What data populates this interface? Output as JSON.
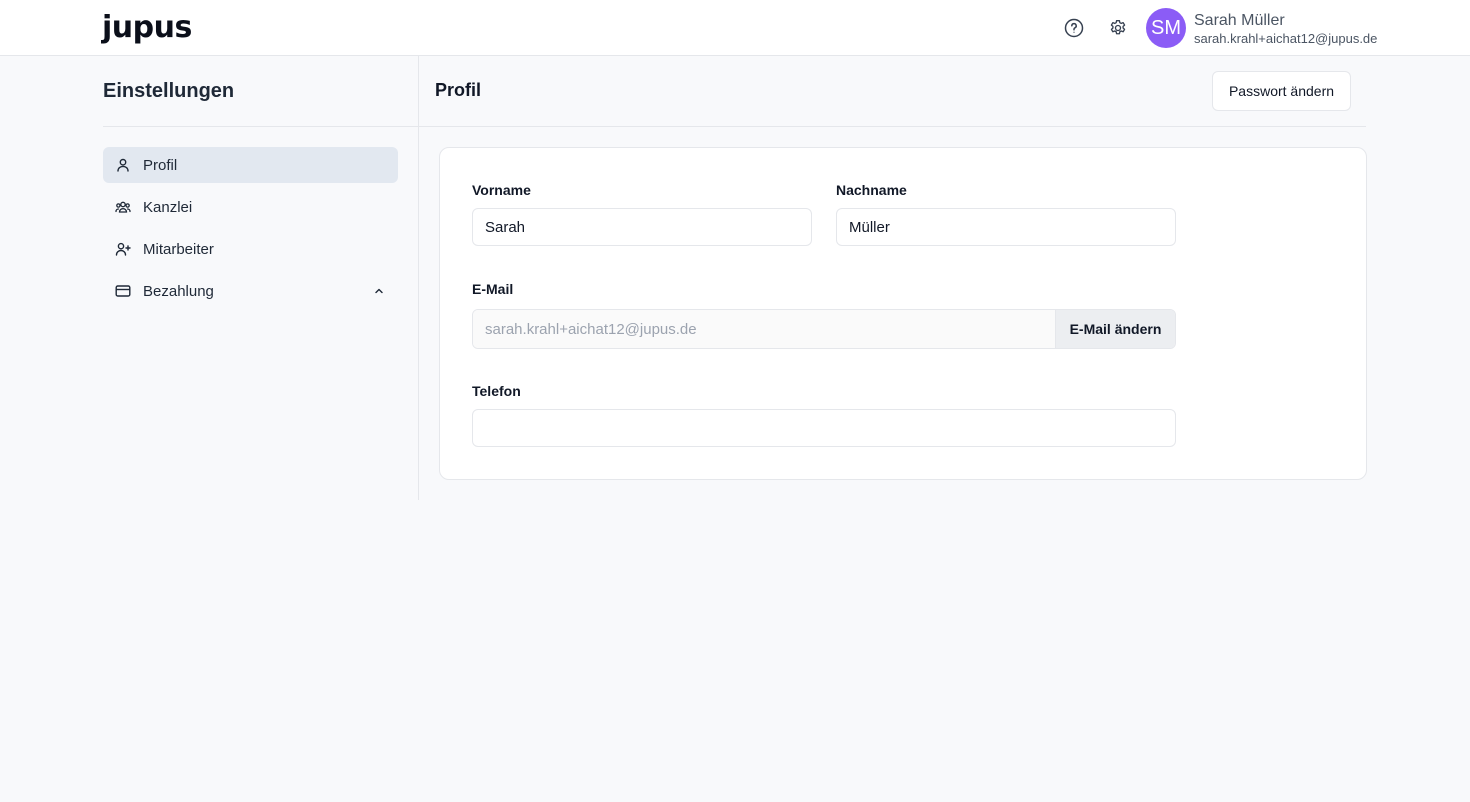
{
  "header": {
    "logo": "jupus",
    "icons": [
      "help-icon",
      "gear-icon"
    ],
    "user": {
      "initials": "SM",
      "name": "Sarah Müller",
      "email": "sarah.krahl+aichat12@jupus.de",
      "avatar_color": "#8b5cf6"
    }
  },
  "sidebar": {
    "title": "Einstellungen",
    "items": [
      {
        "label": "Profil",
        "icon": "user-icon",
        "active": true
      },
      {
        "label": "Kanzlei",
        "icon": "users-icon",
        "active": false
      },
      {
        "label": "Mitarbeiter",
        "icon": "user-plus-icon",
        "active": false
      },
      {
        "label": "Bezahlung",
        "icon": "credit-card-icon",
        "active": false,
        "expand_icon": "chevron-up-icon"
      }
    ]
  },
  "main": {
    "title": "Profil",
    "change_password_label": "Passwort ändern",
    "form": {
      "first_name_label": "Vorname",
      "first_name_value": "Sarah",
      "last_name_label": "Nachname",
      "last_name_value": "Müller",
      "email_label": "E-Mail",
      "email_value": "sarah.krahl+aichat12@jupus.de",
      "email_button_label": "E-Mail ändern",
      "phone_label": "Telefon",
      "phone_value": ""
    }
  },
  "colors": {
    "accent": "#8b5cf6",
    "active_nav_bg": "#e2e8f0",
    "page_bg": "#f8f9fb"
  }
}
